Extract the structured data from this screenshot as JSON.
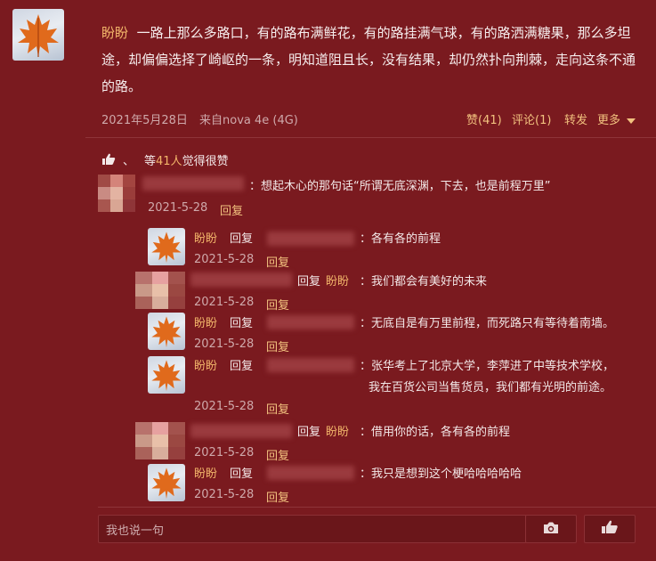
{
  "post": {
    "author": "盼盼",
    "text": "一路上那么多路口，有的路布满鲜花，有的路挂满气球，有的路洒满糖果，那么多坦途，却偏偏选择了崎岖的一条，明知道阻且长，没有结果，却仍然扑向荆棘，走向这条不通的路。",
    "date": "2021年5月28日",
    "source": "来自nova 4e (4G)",
    "like_label": "赞(41)",
    "comment_label": "评论(1)",
    "repost_label": "转发",
    "more_label": "更多"
  },
  "likes": {
    "separator": "、",
    "prefix": "等",
    "count": "41人",
    "suffix": "觉得很赞"
  },
  "top_comment": {
    "text": "：想起木心的那句话“所谓无底深渊，下去，也是前程万里”",
    "date": "2021-5-28",
    "reply_label": "回复"
  },
  "replies": [
    {
      "name": "盼盼",
      "reply_word": "回复",
      "text": "：各有各的前程",
      "date": "2021-5-28",
      "reply_label": "回复"
    },
    {
      "reply_word": "回复",
      "name": "盼盼",
      "text": "：我们都会有美好的未来",
      "date": "2021-5-28",
      "reply_label": "回复"
    },
    {
      "name": "盼盼",
      "reply_word": "回复",
      "text": "：无底自是有万里前程，而死路只有等待着南墙。",
      "date": "2021-5-28",
      "reply_label": "回复"
    },
    {
      "name": "盼盼",
      "reply_word": "回复",
      "text": "：张华考上了北京大学，李萍进了中等技术学校，",
      "text2": "我在百货公司当售货员，我们都有光明的前途。",
      "date": "2021-5-28",
      "reply_label": "回复"
    },
    {
      "reply_word": "回复",
      "name": "盼盼",
      "text": "：借用你的话，各有各的前程",
      "date": "2021-5-28",
      "reply_label": "回复"
    },
    {
      "name": "盼盼",
      "reply_word": "回复",
      "text": "：我只是想到这个梗哈哈哈哈哈",
      "date": "2021-5-28",
      "reply_label": "回复"
    }
  ],
  "reply_input": {
    "placeholder": "我也说一句"
  },
  "colors": {
    "background": "#7a1a1f",
    "name": "#f2b56a",
    "link": "#f2c27f"
  },
  "icons": [
    "maple-leaf-avatar",
    "thumbs-up-icon",
    "caret-down-icon",
    "camera-icon",
    "like-hand-icon"
  ]
}
